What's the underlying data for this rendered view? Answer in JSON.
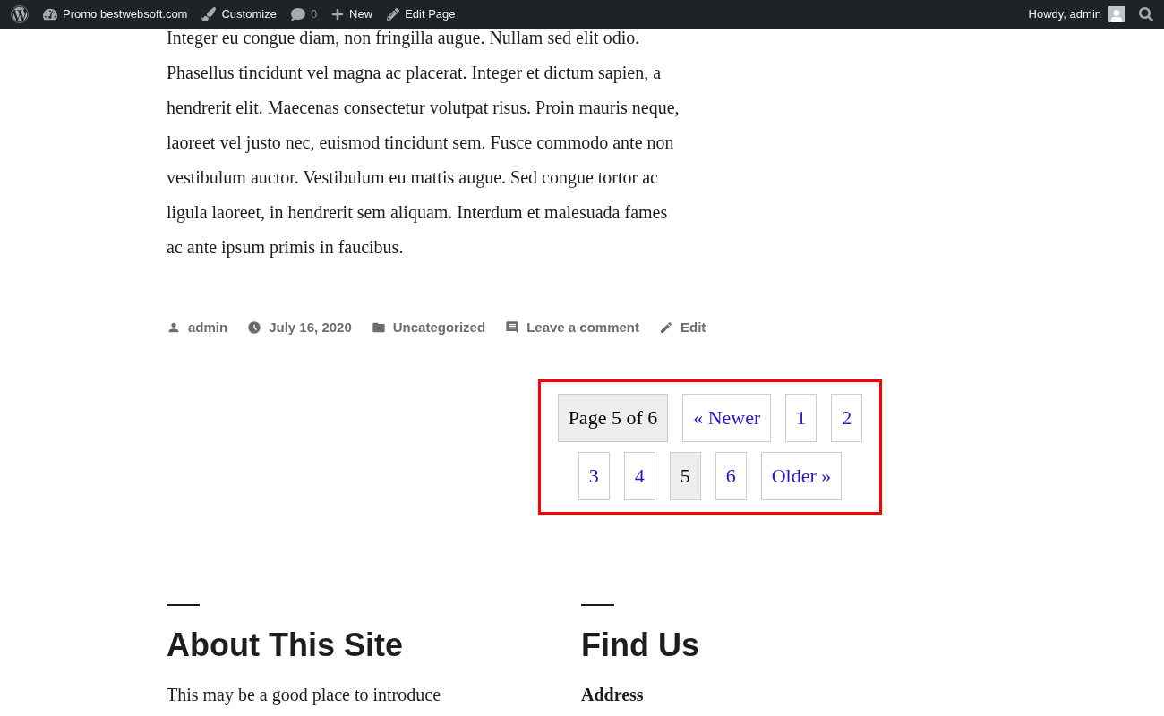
{
  "admin_bar": {
    "left": [
      {
        "kind": "wp-logo"
      },
      {
        "kind": "site",
        "label": "Promo bestwebsoft.com"
      },
      {
        "kind": "customize",
        "label": "Customize"
      },
      {
        "kind": "comments",
        "label": "0"
      },
      {
        "kind": "new",
        "label": "New"
      },
      {
        "kind": "edit",
        "label": "Edit Page"
      }
    ],
    "greeting": "Howdy, admin"
  },
  "post": {
    "paragraph_lines": [
      "Integer eu congue diam, non fringilla augue. Nullam sed elit odio.",
      "Phasellus tincidunt vel magna ac placerat. Integer et dictum sapien, a",
      "hendrerit elit. Maecenas consectetur volutpat risus. Proin mauris neque,",
      "laoreet vel justo nec, euismod tincidunt sem. Fusce commodo ante non",
      "vestibulum auctor. Vestibulum eu mattis augue. Sed congue tortor ac",
      "ligula laoreet, in hendrerit sem aliquam. Interdum et malesuada fames",
      "ac ante ipsum primis in faucibus."
    ],
    "meta": [
      {
        "kind": "author",
        "label": "admin"
      },
      {
        "kind": "date",
        "label": "July 16, 2020"
      },
      {
        "kind": "category",
        "label": "Uncategorized"
      },
      {
        "kind": "comment",
        "label": "Leave a comment"
      },
      {
        "kind": "edit",
        "label": "Edit"
      }
    ]
  },
  "pagination": {
    "highlighted": true,
    "items": [
      {
        "kind": "status",
        "label": "Page 5 of 6"
      },
      {
        "kind": "link",
        "label": "« Newer",
        "selected": false
      },
      {
        "kind": "link",
        "label": "1",
        "selected": false
      },
      {
        "kind": "link",
        "label": "2",
        "selected": false
      },
      {
        "kind": "link",
        "label": "3",
        "selected": false
      },
      {
        "kind": "link",
        "label": "4",
        "selected": false
      },
      {
        "kind": "link",
        "label": "5",
        "selected": true
      },
      {
        "kind": "link",
        "label": "6",
        "selected": false
      },
      {
        "kind": "link",
        "label": "Older »",
        "selected": false
      }
    ]
  },
  "footer": [
    {
      "title": "About This Site",
      "text": "This may be a good place to introduce"
    },
    {
      "title": "Find Us",
      "subtitle": "Address"
    }
  ]
}
